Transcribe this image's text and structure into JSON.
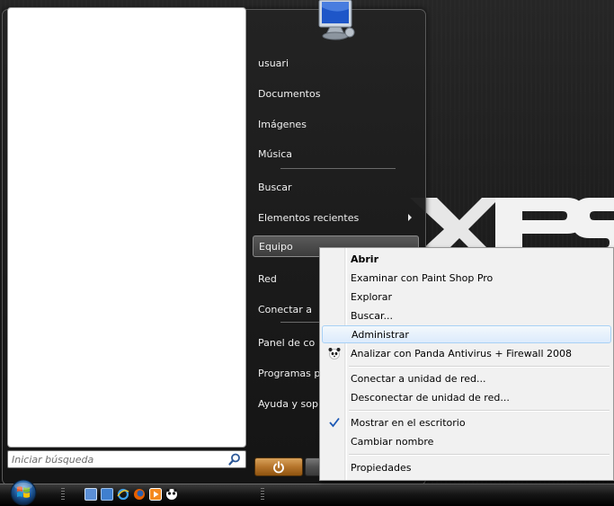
{
  "wallpaper": {
    "logo_text": "XPS"
  },
  "start_menu": {
    "search": {
      "placeholder": "Iniciar búsqueda"
    },
    "right_pane": {
      "items": [
        {
          "label": "usuari"
        },
        {
          "label": "Documentos"
        },
        {
          "label": "Imágenes"
        },
        {
          "label": "Música"
        },
        {
          "label": "Buscar"
        },
        {
          "label": "Elementos recientes",
          "has_submenu": true
        },
        {
          "label": "Equipo",
          "selected": true
        },
        {
          "label": "Red"
        },
        {
          "label": "Conectar a"
        },
        {
          "label": "Panel de co"
        },
        {
          "label": "Programas p"
        },
        {
          "label": "Ayuda y sop"
        }
      ]
    },
    "power_button": {
      "icon": "power-icon"
    },
    "lock_button": {
      "icon": "lock-icon"
    }
  },
  "context_menu": {
    "items": [
      {
        "label": "Abrir",
        "bold": true
      },
      {
        "label": "Examinar con Paint Shop Pro"
      },
      {
        "label": "Explorar"
      },
      {
        "label": "Buscar..."
      },
      {
        "label": "Administrar",
        "highlighted": true
      },
      {
        "label": "Analizar con Panda Antivirus + Firewall 2008",
        "icon": "panda-icon"
      },
      {
        "label": "Conectar a unidad de red..."
      },
      {
        "label": "Desconectar de unidad de red..."
      },
      {
        "label": "Mostrar en el escritorio",
        "checked": true
      },
      {
        "label": "Cambiar nombre"
      },
      {
        "label": "Propiedades"
      }
    ]
  },
  "taskbar": {
    "start_orb": "windows-logo-icon",
    "quick_launch": [
      "show-desktop-icon",
      "switch-windows-icon",
      "internet-explorer-icon",
      "firefox-icon",
      "media-player-icon",
      "panda-icon"
    ]
  },
  "colors": {
    "menu_highlight": "#dcebfc",
    "menu_highlight_border": "#a8d1f5",
    "power_button": "#b5742b"
  }
}
